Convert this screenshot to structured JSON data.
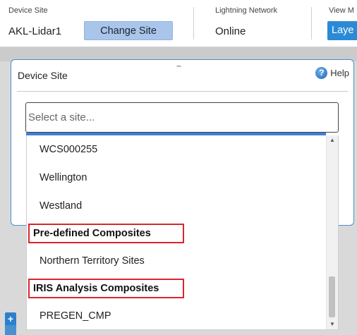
{
  "topbar": {
    "device_site_label": "Device Site",
    "device_site_value": "AKL-Lidar1",
    "change_site_button": "Change Site",
    "lightning_label": "Lightning Network",
    "lightning_value": "Online",
    "view_label": "View M",
    "layers_button": "Laye"
  },
  "panel": {
    "title": "Device Site",
    "help_label": "Help",
    "help_icon": "?"
  },
  "site_select": {
    "placeholder": "Select a site..."
  },
  "dropdown": {
    "items": [
      {
        "label": "WCS000255"
      },
      {
        "label": "Wellington"
      },
      {
        "label": "Westland"
      }
    ],
    "group1": {
      "label": "Pre-defined Composites"
    },
    "group1_items": [
      {
        "label": "Northern Territory Sites"
      }
    ],
    "group2": {
      "label": "IRIS Analysis Composites"
    },
    "group2_items": [
      {
        "label": "PREGEN_CMP"
      }
    ]
  },
  "map_controls": {
    "zoom_in": "+"
  },
  "colors": {
    "accent": "#2a8ad6",
    "change_button": "#a9c6ea",
    "highlight_box": "#d9262e",
    "panel_border": "#4a8fc8"
  }
}
